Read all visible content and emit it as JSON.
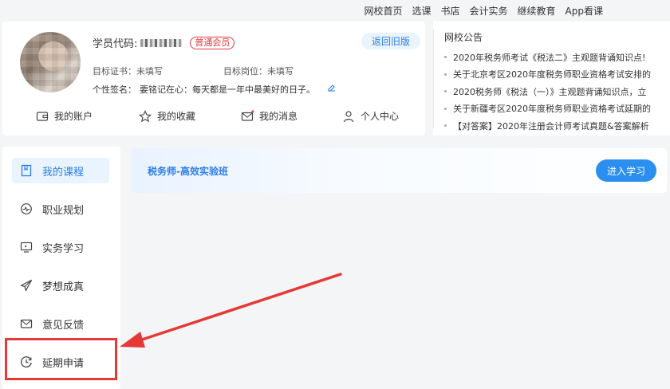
{
  "topnav": [
    "网校首页",
    "选课",
    "书店",
    "会计实务",
    "继续教育",
    "App看课"
  ],
  "profile": {
    "id_label": "学员代码:",
    "member_badge": "普通会员",
    "old_version_label": "返回旧版",
    "goal_cert": "目标证书：未填写",
    "goal_job": "目标岗位：未填写",
    "sign_label": "个性签名：",
    "sign_text": "要铭记在心：每天都是一年中最美好的日子。"
  },
  "quick_links": [
    {
      "label": "我的账户",
      "icon": "wallet-icon"
    },
    {
      "label": "我的收藏",
      "icon": "star-icon"
    },
    {
      "label": "我的消息",
      "icon": "mail-icon"
    },
    {
      "label": "个人中心",
      "icon": "user-icon"
    }
  ],
  "notice": {
    "title": "网校公告",
    "items": [
      "2020年税务师考试《税法二》主观题背诵知识点!",
      "关于北京考区2020年度税务师职业资格考试安排的",
      "2020税务师《税法（一）》主观题背诵知识点，立",
      "关于新疆考区2020年度税务师职业资格考试延期的",
      "【对答案】2020年注册会计师考试真题&答案解析"
    ]
  },
  "sidebar": {
    "items": [
      {
        "label": "我的课程",
        "icon": "book-icon",
        "active": true
      },
      {
        "label": "职业规划",
        "icon": "career-icon",
        "active": false
      },
      {
        "label": "实务学习",
        "icon": "monitor-icon",
        "active": false
      },
      {
        "label": "梦想成真",
        "icon": "paper-plane-icon",
        "active": false
      },
      {
        "label": "意见反馈",
        "icon": "mail-icon",
        "active": false
      },
      {
        "label": "延期申请",
        "icon": "clock-icon",
        "active": false
      }
    ]
  },
  "course": {
    "title": "税务师-高效实验班",
    "enter_label": "进入学习"
  },
  "colors": {
    "accent": "#2b7de9",
    "highlight": "#e53935"
  }
}
